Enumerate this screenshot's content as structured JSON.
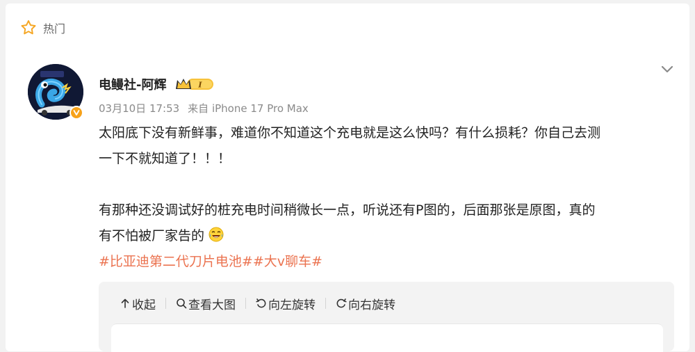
{
  "section": {
    "label": "热门",
    "icon": "star-icon"
  },
  "post": {
    "author": "电鳗社-阿辉",
    "rank_badge_text": "I",
    "date": "03月10日 17:53",
    "source": "来自 iPhone 17 Pro Max",
    "paragraph1_line1": "太阳底下没有新鲜事，难道你不知道这个充电就是这么快吗？有什么损耗？你自己去测",
    "paragraph1_line2": "一下不就知道了！！！",
    "paragraph2_line1": "有那种还没调试好的桩充电时间稍微长一点，听说还有P图的，后面那张是原图，真的",
    "paragraph2_line2": "有不怕被厂家告的",
    "hashtags": [
      "#比亚迪第二代刀片电池#",
      "#大v聊车#"
    ]
  },
  "toolbar": {
    "collapse_label": "收起",
    "view_large_label": "查看大图",
    "rotate_left_label": "向左旋转",
    "rotate_right_label": "向右旋转"
  },
  "colors": {
    "hashtag": "#eb7350",
    "badge_gold": "#f7a21a",
    "page_bg": "#f2f2f2"
  }
}
